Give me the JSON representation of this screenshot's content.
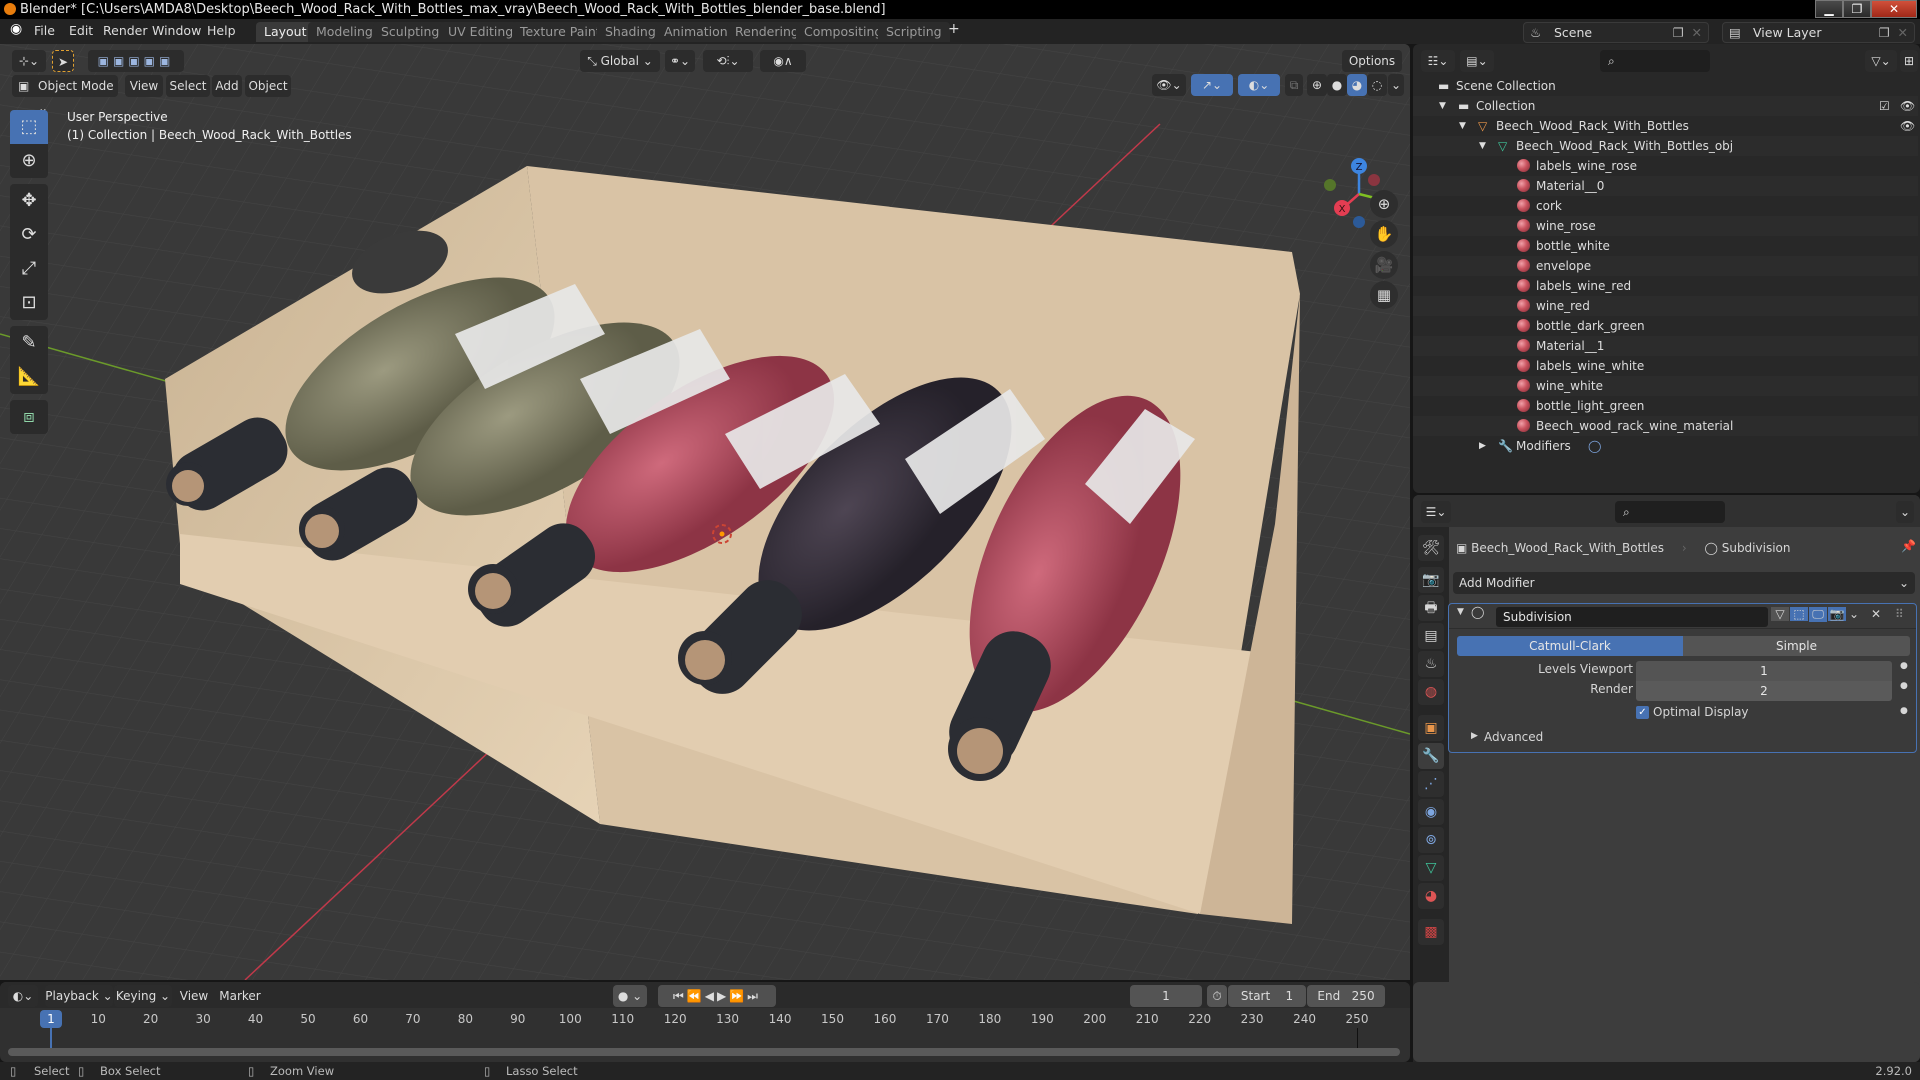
{
  "window": {
    "title": "Blender* [C:\\Users\\AMDA8\\Desktop\\Beech_Wood_Rack_With_Bottles_max_vray\\Beech_Wood_Rack_With_Bottles_blender_base.blend]",
    "controls": [
      "minimize",
      "maximize",
      "close"
    ]
  },
  "menubar": {
    "items": [
      "File",
      "Edit",
      "Render",
      "Window",
      "Help"
    ],
    "workspaces": [
      "Layout",
      "Modeling",
      "Sculpting",
      "UV Editing",
      "Texture Paint",
      "Shading",
      "Animation",
      "Rendering",
      "Compositing",
      "Scripting"
    ],
    "active_workspace": "Layout",
    "add_workspace": "+",
    "scene": "Scene",
    "view_layer": "View Layer"
  },
  "viewport": {
    "mode": "Object Mode",
    "menus": [
      "View",
      "Select",
      "Add",
      "Object"
    ],
    "orientation": "Global",
    "options_label": "Options",
    "overlay_title": "User Perspective",
    "overlay_subtitle": "(1) Collection | Beech_Wood_Rack_With_Bottles",
    "gizmo_axes": [
      "X",
      "Y",
      "Z"
    ],
    "tools": [
      "select-box",
      "cursor",
      "move",
      "rotate",
      "scale",
      "transform",
      "annotate",
      "measure",
      "add-cube"
    ],
    "shading_modes": [
      "wireframe",
      "solid",
      "material-preview",
      "rendered"
    ],
    "active_shading": "material-preview",
    "colors": {
      "background": "#393939",
      "x_axis": "#c0394a",
      "y_axis": "#6b9a2a",
      "wood": "#d9c3a5"
    }
  },
  "outliner": {
    "root": "Scene Collection",
    "collection": "Collection",
    "object": "Beech_Wood_Rack_With_Bottles",
    "mesh": "Beech_Wood_Rack_With_Bottles_obj",
    "materials": [
      "labels_wine_rose",
      "Material__0",
      "cork",
      "wine_rose",
      "bottle_white",
      "envelope",
      "labels_wine_red",
      "wine_red",
      "bottle_dark_green",
      "Material__1",
      "labels_wine_white",
      "wine_white",
      "bottle_light_green",
      "Beech_wood_rack_wine_material"
    ],
    "modifiers_label": "Modifiers"
  },
  "properties": {
    "breadcrumb_object": "Beech_Wood_Rack_With_Bottles",
    "breadcrumb_modifier": "Subdivision",
    "add_modifier": "Add Modifier",
    "modifier_name": "Subdivision",
    "algorithm_options": [
      "Catmull-Clark",
      "Simple"
    ],
    "active_algorithm": "Catmull-Clark",
    "levels_viewport_label": "Levels Viewport",
    "levels_viewport": "1",
    "render_label": "Render",
    "render_levels": "2",
    "optimal_display_label": "Optimal Display",
    "optimal_display": true,
    "advanced_label": "Advanced",
    "accent": "#4772b3"
  },
  "timeline": {
    "menus": [
      "Playback",
      "Keying",
      "View",
      "Marker"
    ],
    "current_frame": "1",
    "start_label": "Start",
    "start": "1",
    "end_label": "End",
    "end": "250",
    "ticks": [
      "10",
      "20",
      "30",
      "40",
      "50",
      "60",
      "70",
      "80",
      "90",
      "100",
      "110",
      "120",
      "130",
      "140",
      "150",
      "160",
      "170",
      "180",
      "190",
      "200",
      "210",
      "220",
      "230",
      "240",
      "250"
    ]
  },
  "statusbar": {
    "select": "Select",
    "box_select": "Box Select",
    "zoom_view": "Zoom View",
    "lasso_select": "Lasso Select",
    "version": "2.92.0"
  }
}
